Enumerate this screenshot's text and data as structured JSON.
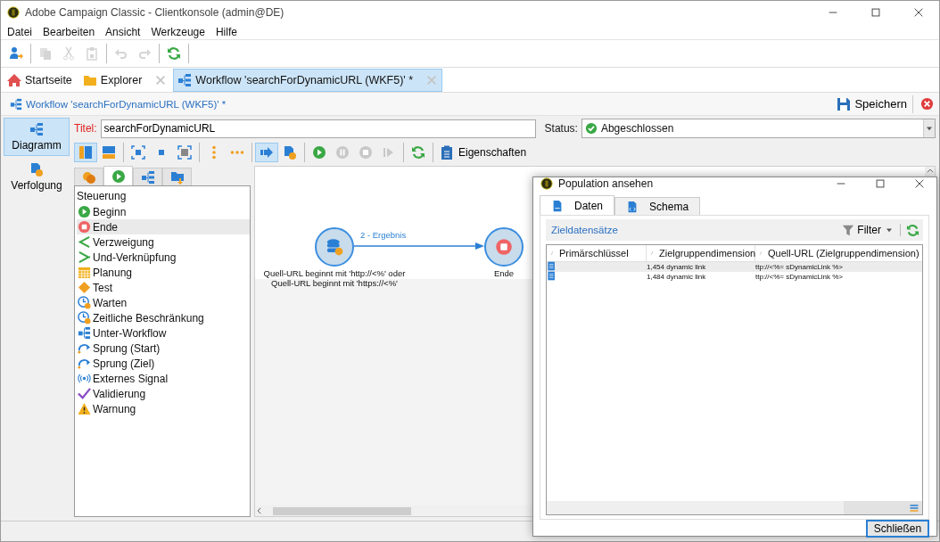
{
  "window": {
    "title": "Adobe Campaign Classic - Clientkonsole (admin@DE)"
  },
  "menu": [
    "Datei",
    "Bearbeiten",
    "Ansicht",
    "Werkzeuge",
    "Hilfe"
  ],
  "toolbar": {
    "groups": [
      [
        {
          "kind": "user-add",
          "disabled": false
        }
      ],
      [
        {
          "kind": "copy",
          "disabled": true
        },
        {
          "kind": "cut",
          "disabled": true
        },
        {
          "kind": "paste",
          "disabled": true
        }
      ],
      [
        {
          "kind": "undo",
          "disabled": true
        },
        {
          "kind": "redo",
          "disabled": true
        }
      ],
      [
        {
          "kind": "refresh",
          "disabled": false
        }
      ]
    ]
  },
  "tabs": [
    {
      "label": "Startseite",
      "kind": "home",
      "selected": false,
      "closable": false
    },
    {
      "label": "Explorer",
      "kind": "folder",
      "selected": false,
      "closable": true
    },
    {
      "label": "Workflow 'searchForDynamicURL (WKF5)' *",
      "kind": "workflow",
      "selected": true,
      "closable": true
    }
  ],
  "breadcrumb": "Workflow 'searchForDynamicURL (WKF5)' *",
  "save_button": "Speichern",
  "sidebar": {
    "items": [
      {
        "label": "Diagramm",
        "kind": "workflow",
        "selected": true
      },
      {
        "label": "Verfolgung",
        "kind": "doc-badge",
        "selected": false
      }
    ]
  },
  "title_field": {
    "label": "Titel:",
    "value": "searchForDynamicURL"
  },
  "status_field": {
    "label": "Status:",
    "value": "Abgeschlossen"
  },
  "editor_toolbar": {
    "groups": [
      [
        {
          "kind": "col-layout",
          "selected": true
        },
        {
          "kind": "row-layout",
          "selected": false
        }
      ],
      [
        {
          "kind": "fit",
          "selected": false
        },
        {
          "kind": "square",
          "selected": false
        },
        {
          "kind": "frame",
          "selected": false
        }
      ],
      [
        {
          "kind": "dots-v",
          "selected": false
        },
        {
          "kind": "dots-h",
          "selected": false
        }
      ],
      [
        {
          "kind": "arrow",
          "selected": true
        },
        {
          "kind": "doc-badge",
          "selected": false
        }
      ],
      [
        {
          "kind": "play",
          "selected": false
        },
        {
          "kind": "pause",
          "selected": false
        },
        {
          "kind": "stop",
          "selected": false
        },
        {
          "kind": "step",
          "selected": false
        }
      ],
      [
        {
          "kind": "refresh",
          "selected": false
        }
      ]
    ],
    "properties_button": "Eigenschaften"
  },
  "palette": {
    "tabs": [
      {
        "kind": "circles",
        "selected": false
      },
      {
        "kind": "play",
        "selected": true
      },
      {
        "kind": "workflow",
        "selected": false
      },
      {
        "kind": "folder-arrow",
        "selected": false
      }
    ],
    "heading": "Steuerung",
    "items": [
      {
        "label": "Beginn",
        "kind": "play",
        "selected": false
      },
      {
        "label": "Ende",
        "kind": "end",
        "selected": true
      },
      {
        "label": "Verzweigung",
        "kind": "fork",
        "selected": false
      },
      {
        "label": "Und-Verknüpfung",
        "kind": "join",
        "selected": false
      },
      {
        "label": "Planung",
        "kind": "calendar",
        "selected": false
      },
      {
        "label": "Test",
        "kind": "diamond",
        "selected": false
      },
      {
        "label": "Warten",
        "kind": "clock",
        "selected": false
      },
      {
        "label": "Zeitliche Beschränkung",
        "kind": "clock",
        "selected": false
      },
      {
        "label": "Unter-Workflow",
        "kind": "workflow",
        "selected": false
      },
      {
        "label": "Sprung (Start)",
        "kind": "jump",
        "selected": false
      },
      {
        "label": "Sprung (Ziel)",
        "kind": "jump",
        "selected": false
      },
      {
        "label": "Externes Signal",
        "kind": "signal",
        "selected": false
      },
      {
        "label": "Validierung",
        "kind": "validate",
        "selected": false
      },
      {
        "label": "Warnung",
        "kind": "warning",
        "selected": false
      }
    ]
  },
  "canvas": {
    "nodes": [
      {
        "kind": "database",
        "label": "Quell-URL beginnt mit 'http://<%' oder Quell-URL beginnt mit 'https://<%'"
      },
      {
        "kind": "end",
        "label": "Ende"
      }
    ],
    "transitions": [
      {
        "label": "2 - Ergebnis"
      }
    ]
  },
  "dialog": {
    "title": "Population ansehen",
    "tabs": [
      {
        "label": "Daten",
        "kind": "sql",
        "selected": true
      },
      {
        "label": "Schema",
        "kind": "xml",
        "selected": false
      }
    ],
    "section_title": "Zieldatensätze",
    "filter_button": "Filter",
    "table": {
      "columns": [
        "Primärschlüssel",
        "Zielgruppendimension",
        "Quell-URL (Zielgruppendimension)"
      ],
      "rows": [
        {
          "selected": true,
          "dimension": "1,454 dynamic link",
          "url": "ttp://<%= sDynamicLink %>"
        },
        {
          "selected": false,
          "dimension": "1,484 dynamic link",
          "url": "ttp://<%= sDynamicLink %>"
        }
      ]
    },
    "close_button": "Schließen"
  }
}
